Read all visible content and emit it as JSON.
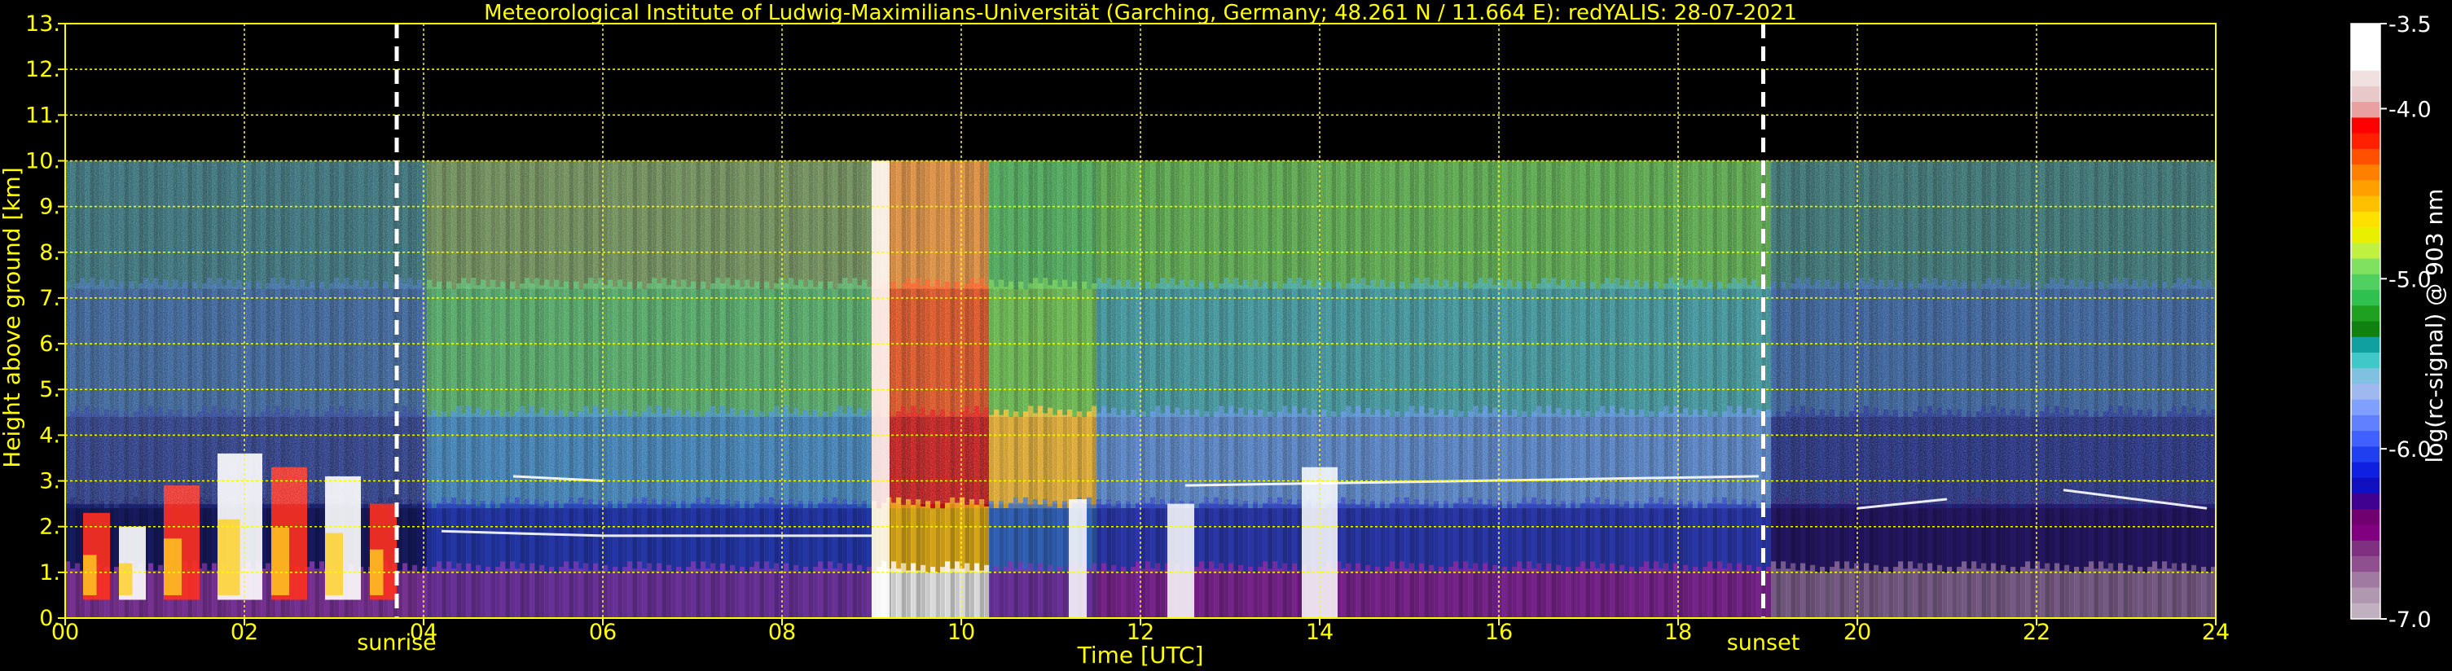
{
  "chart_data": {
    "type": "heatmap",
    "title": "Meteorological Institute of Ludwig-Maximilians-Universität (Garching, Germany; 48.261 N / 11.664 E):    redYALIS: 28-07-2021",
    "xlabel": "Time [UTC]",
    "ylabel": "Height above ground [km]",
    "xlim": [
      0,
      24
    ],
    "ylim": [
      0,
      13
    ],
    "x_ticks": [
      0,
      2,
      4,
      6,
      8,
      10,
      12,
      14,
      16,
      18,
      20,
      22,
      24
    ],
    "x_tick_labels": [
      "00",
      "02",
      "04",
      "06",
      "08",
      "10",
      "12",
      "14",
      "16",
      "18",
      "20",
      "22",
      "24"
    ],
    "y_ticks": [
      0,
      1,
      2,
      3,
      4,
      5,
      6,
      7,
      8,
      9,
      10,
      11,
      12,
      13
    ],
    "y_tick_labels": [
      "0.",
      "1.",
      "2.",
      "3.",
      "4.",
      "5.",
      "6.",
      "7.",
      "8.",
      "9.",
      "10.",
      "11.",
      "12.",
      "13."
    ],
    "grid": true,
    "data_top_km": 10,
    "annotations": [
      {
        "label": "sunrise",
        "x": 3.7
      },
      {
        "label": "sunset",
        "x": 18.95
      }
    ],
    "colorbar": {
      "label": "log(rc-signal) @ 903 nm",
      "range": [
        -7.0,
        -3.5
      ],
      "tick_values": [
        -3.5,
        -4.0,
        -5.0,
        -6.0,
        -7.0
      ],
      "tick_labels": [
        "-3.5",
        "-4.0",
        "-5.0",
        "-6.0",
        "-7.0"
      ]
    },
    "colors": {
      "axes": "#ffff00",
      "background": "#000000",
      "grid": "#ffff00",
      "annotation_lines": "#ffffff"
    }
  }
}
